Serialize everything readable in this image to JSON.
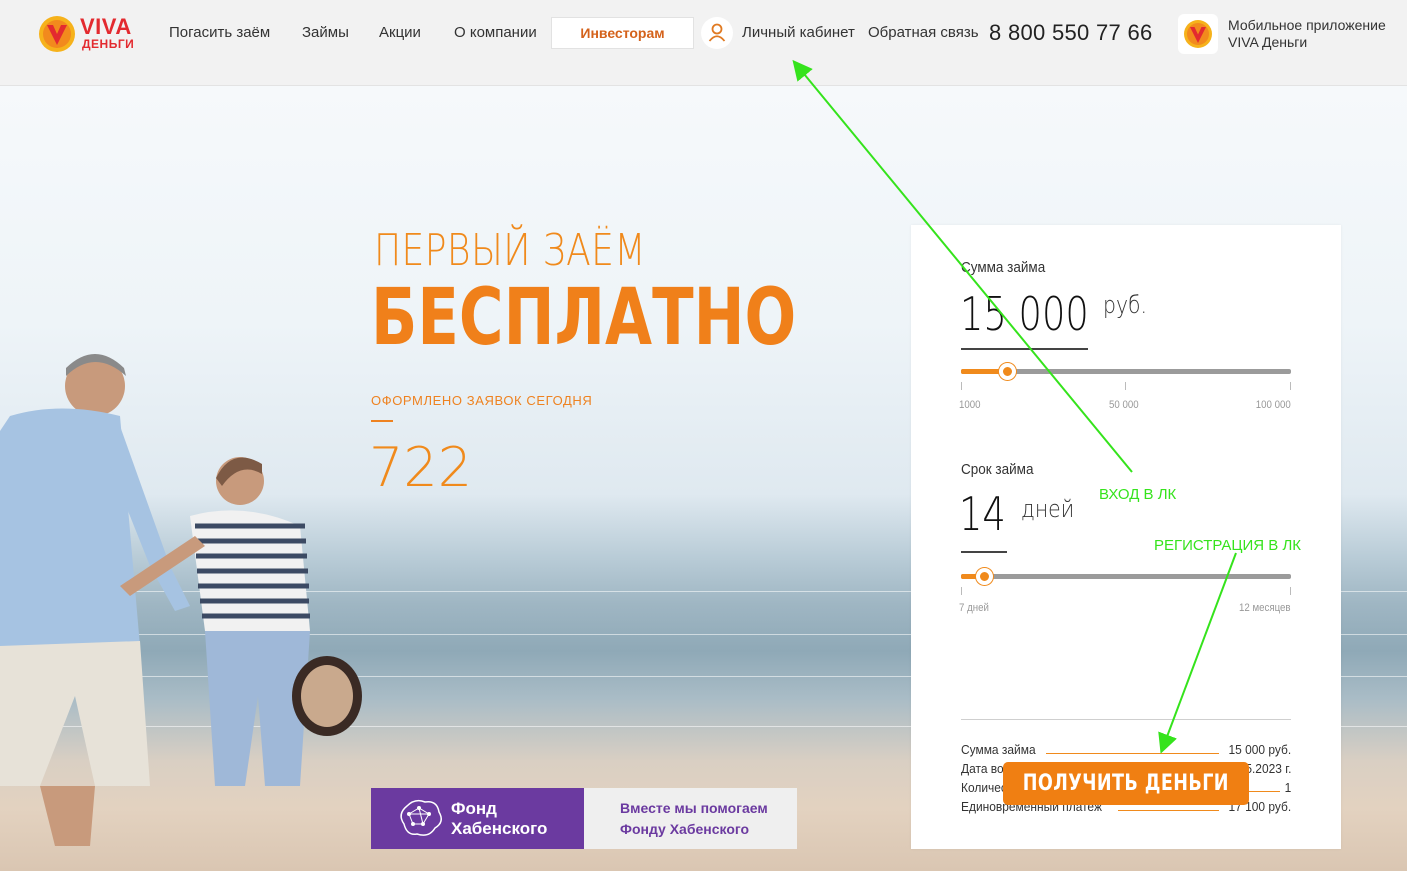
{
  "header": {
    "logo_viva": "VIVA",
    "logo_dengi": "ДЕНЬГИ",
    "nav": [
      "Погасить заём",
      "Займы",
      "Акции",
      "О компании"
    ],
    "investors": "Инвесторам",
    "cabinet": "Личный кабинет",
    "feedback": "Обратная связь",
    "phone": "8 800 550 77 66",
    "app_line1": "Мобильное приложение",
    "app_line2": "VIVA Деньги"
  },
  "hero": {
    "title_line1": "ПЕРВЫЙ ЗАЁМ",
    "title_line2": "БЕСПЛАТНО",
    "applied_label": "ОФОРМЛЕНО ЗАЯВОК СЕГОДНЯ",
    "applied_count": "722"
  },
  "fund": {
    "title_line1": "Фонд",
    "title_line2": "Хабенского",
    "text_line1": "Вместе мы помогаем",
    "text_line2": "Фонду Хабенского"
  },
  "calculator": {
    "amount_label": "Сумма займа",
    "amount_value": "15 000",
    "amount_unit": "руб.",
    "amount_slider_fraction": 0.14,
    "amount_ticks": [
      "1000",
      "50 000",
      "100 000"
    ],
    "term_label": "Срок займа",
    "term_value": "14",
    "term_unit": "дней",
    "term_slider_fraction": 0.07,
    "term_ticks": [
      "7 дней",
      "12 месяцев"
    ],
    "summary": [
      {
        "key": "Сумма займа",
        "value": "15 000 руб."
      },
      {
        "key": "Дата возврата",
        "value": "05.05.2023 г."
      },
      {
        "key": "Количество платежей",
        "value": "1"
      },
      {
        "key": "Единовременный платеж",
        "value": "17 100 руб."
      }
    ],
    "button": "ПОЛУЧИТЬ ДЕНЬГИ"
  },
  "annotations": {
    "login": "ВХОД В ЛК",
    "register": "РЕГИСТРАЦИЯ В ЛК",
    "color": "#35e31c"
  },
  "colors": {
    "accent": "#f08a1c",
    "brand_red": "#e32a2f",
    "fund_purple": "#6b3aa0"
  }
}
